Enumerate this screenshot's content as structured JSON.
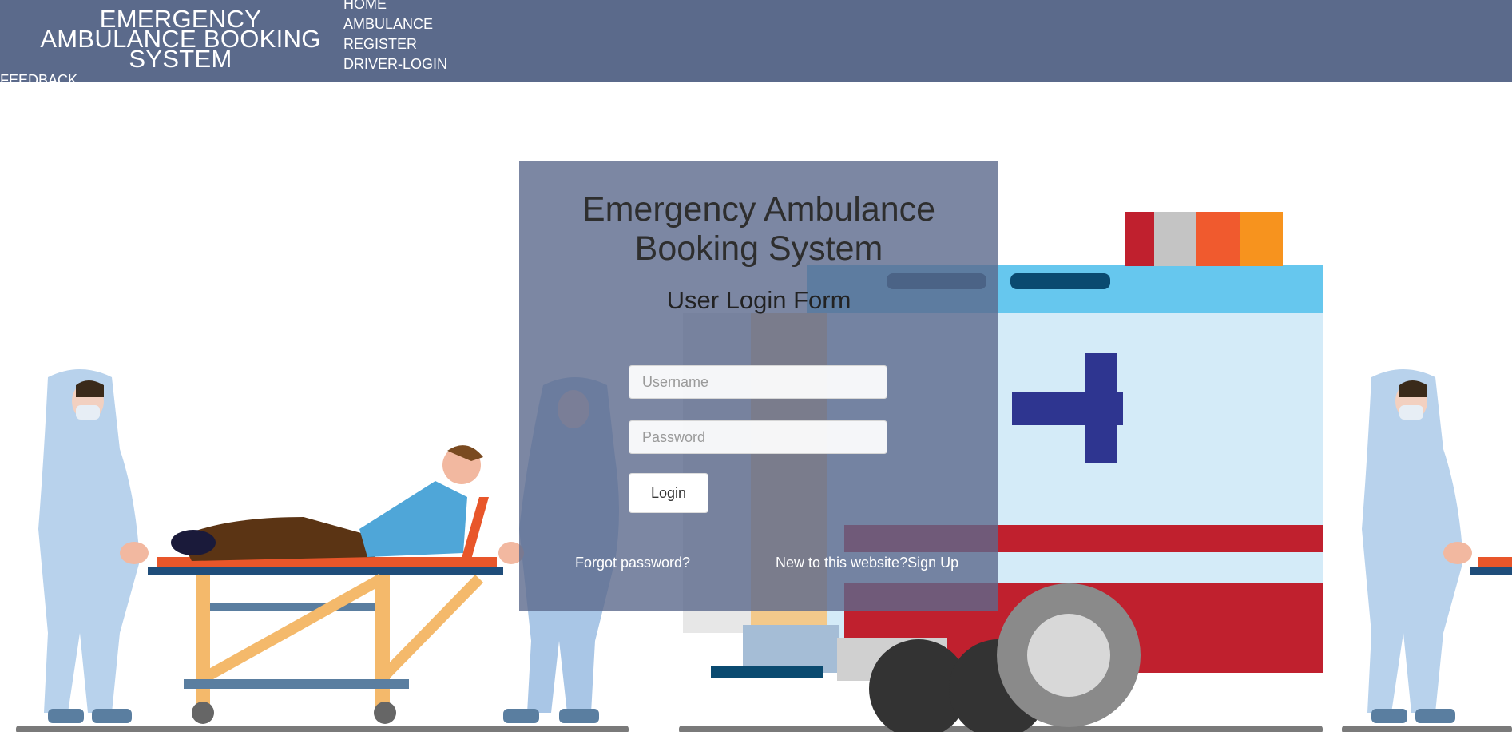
{
  "header": {
    "brand_title": "EMERGENCY AMBULANCE BOOKING SYSTEM",
    "nav": [
      "HOME",
      "AMBULANCE",
      "REGISTER",
      "DRIVER-LOGIN"
    ],
    "feedback": "FEEDBACK",
    "bg_color": "#5b6a8b"
  },
  "login": {
    "title": "Emergency Ambulance Booking System",
    "subtitle": "User Login Form",
    "username_placeholder": "Username",
    "password_placeholder": "Password",
    "login_label": "Login",
    "forgot_link": "Forgot password?",
    "signup_link": "New to this website?Sign Up"
  },
  "illustration": {
    "subject": "medical workers in protective suits carrying a patient on a stretcher to an ambulance",
    "colors": {
      "ambulance_red": "#c0202e",
      "ambulance_blue": "#66c7ee",
      "cross": "#2e3590",
      "stretcher": "#e8562a"
    }
  }
}
